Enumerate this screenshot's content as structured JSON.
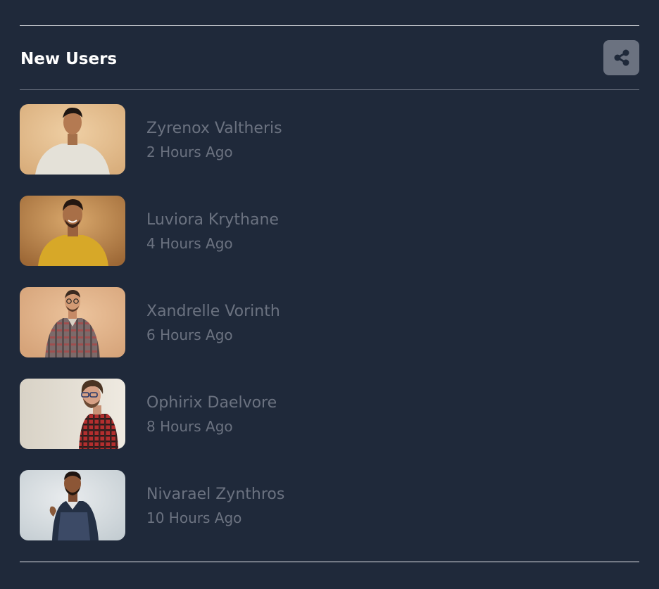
{
  "header": {
    "title": "New Users",
    "share_icon": "share-icon"
  },
  "colors": {
    "background": "#1f293a",
    "muted_text": "#6b7280",
    "title": "#ffffff",
    "share_button": "#6b7280"
  },
  "users": [
    {
      "name": "Zyrenox Valtheris",
      "time": "2 Hours Ago",
      "photo": "person-photo"
    },
    {
      "name": "Luviora Krythane",
      "time": "4 Hours Ago",
      "photo": "person-photo"
    },
    {
      "name": "Xandrelle Vorinth",
      "time": "6 Hours Ago",
      "photo": "person-photo"
    },
    {
      "name": "Ophirix Daelvore",
      "time": "8 Hours Ago",
      "photo": "person-photo"
    },
    {
      "name": "Nivarael Zynthros",
      "time": "10 Hours Ago",
      "photo": "person-photo"
    }
  ]
}
